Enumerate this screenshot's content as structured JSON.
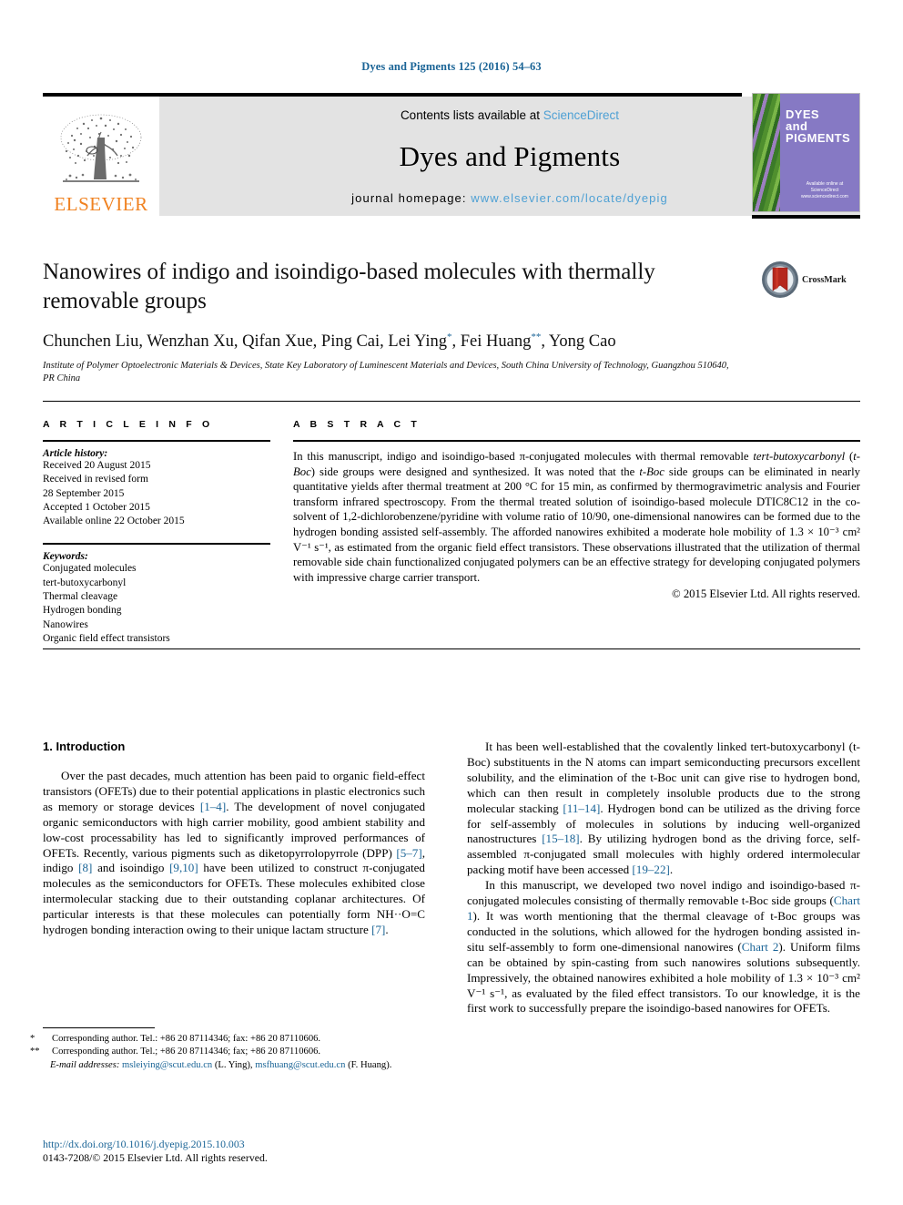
{
  "running_head": "Dyes and Pigments 125 (2016) 54–63",
  "masthead": {
    "publisher_name": "ELSEVIER",
    "contents_prefix": "Contents lists available at ",
    "contents_link": "ScienceDirect",
    "journal_title": "Dyes and Pigments",
    "homepage_prefix": "journal homepage: ",
    "homepage_link": "www.elsevier.com/locate/dyepig",
    "cover": {
      "line1": "DYES",
      "line2": "and",
      "line3": "PIGMENTS",
      "footer1": "Available online at",
      "footer2": "ScienceDirect",
      "footer3": "www.sciencedirect.com"
    }
  },
  "article": {
    "title": "Nanowires of indigo and isoindigo-based molecules with thermally removable groups",
    "authors_prefix": "Chunchen Liu, Wenzhan Xu, Qifan Xue, Ping Cai, Lei Ying",
    "author_mark1": "*",
    "authors_mid": ", Fei Huang",
    "author_mark2": "**",
    "authors_suffix": ", Yong Cao",
    "affiliation": "Institute of Polymer Optoelectronic Materials & Devices, State Key Laboratory of Luminescent Materials and Devices, South China University of Technology, Guangzhou 510640, PR China",
    "crossmark_label": "CrossMark"
  },
  "article_info": {
    "heading": "A R T I C L E  I N F O",
    "history_label": "Article history:",
    "history": [
      "Received 20 August 2015",
      "Received in revised form",
      "28 September 2015",
      "Accepted 1 October 2015",
      "Available online 22 October 2015"
    ],
    "keywords_label": "Keywords:",
    "keywords": [
      "Conjugated molecules",
      "tert-butoxycarbonyl",
      "Thermal cleavage",
      "Hydrogen bonding",
      "Nanowires",
      "Organic field effect transistors"
    ]
  },
  "abstract": {
    "heading": "A B S T R A C T",
    "text": "In this manuscript, indigo and isoindigo-based π-conjugated molecules with thermal removable tert-butoxycarbonyl (t-Boc) side groups were designed and synthesized. It was noted that the t-Boc side groups can be eliminated in nearly quantitative yields after thermal treatment at 200 °C for 15 min, as confirmed by thermogravimetric analysis and Fourier transform infrared spectroscopy. From the thermal treated solution of isoindigo-based molecule DTIC8C12 in the co-solvent of 1,2-dichlorobenzene/pyridine with volume ratio of 10/90, one-dimensional nanowires can be formed due to the hydrogen bonding assisted self-assembly. The afforded nanowires exhibited a moderate hole mobility of 1.3 × 10⁻³ cm² V⁻¹ s⁻¹, as estimated from the organic field effect transistors. These observations illustrated that the utilization of thermal removable side chain functionalized conjugated polymers can be an effective strategy for developing conjugated polymers with impressive charge carrier transport.",
    "copyright": "© 2015 Elsevier Ltd. All rights reserved."
  },
  "body": {
    "section_heading": "1. Introduction",
    "left_paragraphs": [
      "Over the past decades, much attention has been paid to organic field-effect transistors (OFETs) due to their potential applications in plastic electronics such as memory or storage devices [1–4]. The development of novel conjugated organic semiconductors with high carrier mobility, good ambient stability and low-cost processability has led to significantly improved performances of OFETs. Recently, various pigments such as diketopyrrolopyrrole (DPP) [5–7], indigo [8] and isoindigo [9,10] have been utilized to construct π-conjugated molecules as the semiconductors for OFETs. These molecules exhibited close intermolecular stacking due to their outstanding coplanar architectures. Of particular interests is that these molecules can potentially form NH··O=C hydrogen bonding interaction owing to their unique lactam structure [7]."
    ],
    "right_paragraphs": [
      "It has been well-established that the covalently linked tert-butoxycarbonyl (t-Boc) substituents in the N atoms can impart semiconducting precursors excellent solubility, and the elimination of the t-Boc unit can give rise to hydrogen bond, which can then result in completely insoluble products due to the strong molecular stacking [11–14]. Hydrogen bond can be utilized as the driving force for self-assembly of molecules in solutions by inducing well-organized nanostructures [15–18]. By utilizing hydrogen bond as the driving force, self-assembled π-conjugated small molecules with highly ordered intermolecular packing motif have been accessed [19–22].",
      "In this manuscript, we developed two novel indigo and isoindigo-based π-conjugated molecules consisting of thermally removable t-Boc side groups (Chart 1). It was worth mentioning that the thermal cleavage of t-Boc groups was conducted in the solutions, which allowed for the hydrogen bonding assisted in-situ self-assembly to form one-dimensional nanowires (Chart 2). Uniform films can be obtained by spin-casting from such nanowires solutions subsequently. Impressively, the obtained nanowires exhibited a hole mobility of 1.3 × 10⁻³ cm² V⁻¹ s⁻¹, as evaluated by the filed effect transistors. To our knowledge, it is the first work to successfully prepare the isoindigo-based nanowires for OFETs."
    ],
    "inline_refs": [
      "[1–4]",
      "[5–7]",
      "[8]",
      "[9,10]",
      "[7]",
      "[11–14]",
      "[15–18]",
      "[19–22]",
      "Chart 1",
      "Chart 2"
    ]
  },
  "footnotes": {
    "note1_marker": "*",
    "note1": "Corresponding author. Tel.: +86 20 87114346; fax: +86 20 87110606.",
    "note2_marker": "**",
    "note2": "Corresponding author. Tel.; +86 20 87114346; fax; +86 20 87110606.",
    "email_label": "E-mail addresses:",
    "email1": "msleiying@scut.edu.cn",
    "email1_owner": "(L. Ying),",
    "email2": "msfhuang@scut.edu.cn",
    "email2_owner": "(F. Huang)."
  },
  "footer": {
    "doi": "http://dx.doi.org/10.1016/j.dyepig.2015.10.003",
    "issn_copyright": "0143-7208/© 2015 Elsevier Ltd. All rights reserved."
  },
  "colors": {
    "link_blue": "#1a6496",
    "sciencedirect_blue": "#4ea0d4",
    "elsevier_orange": "#f08221",
    "banner_grey": "#e3e3e3",
    "cover_purple": "#8679c4"
  }
}
